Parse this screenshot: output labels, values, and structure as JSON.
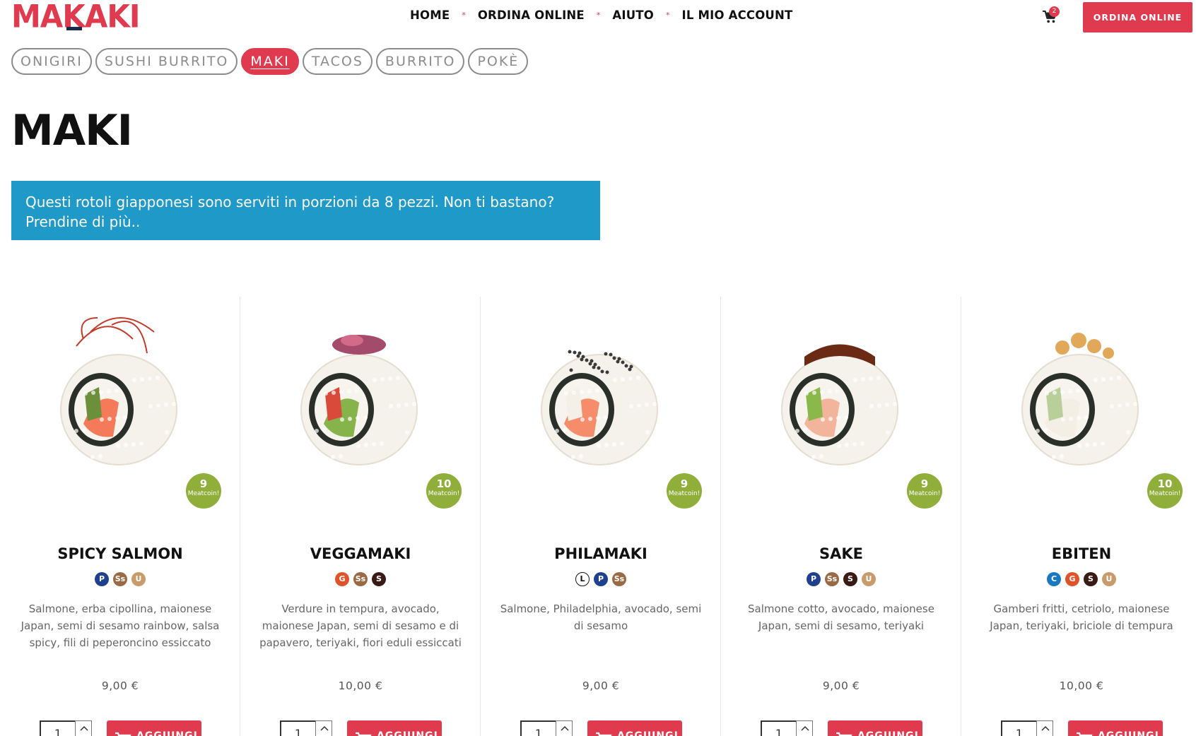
{
  "header": {
    "logo": "MAKAKI",
    "nav": [
      {
        "label": "HOME"
      },
      {
        "label": "ORDINA ONLINE"
      },
      {
        "label": "AIUTO"
      },
      {
        "label": "IL MIO ACCOUNT"
      }
    ],
    "nav_separator": "*",
    "cart_count": "2",
    "cta_label": "ORDINA ONLINE"
  },
  "categories": [
    {
      "label": "ONIGIRI",
      "active": false
    },
    {
      "label": "SUSHI BURRITO",
      "active": false
    },
    {
      "label": "MAKI",
      "active": true
    },
    {
      "label": "TACOS",
      "active": false
    },
    {
      "label": "BURRITO",
      "active": false
    },
    {
      "label": "POKÈ",
      "active": false
    }
  ],
  "page_title": "MAKI",
  "info_text": "Questi rotoli giapponesi sono serviti in porzioni da 8 pezzi. Non ti bastano? Prendine di più..",
  "badge_label": "Meatcoin!",
  "add_label": "AGGIUNGI",
  "qty_default": "1",
  "allergen_colors": {
    "P": "#1f3f8f",
    "Ss": "#9a6a45",
    "U": "#c99a6a",
    "G": "#e0522a",
    "S": "#3a1a14",
    "L": "#ffffff",
    "C": "#1a78c2"
  },
  "products": [
    {
      "name": "SPICY SALMON",
      "allergens": [
        "P",
        "Ss",
        "U"
      ],
      "description": "Salmone, erba cipollina, maionese Japan, semi di sesamo rainbow, salsa spicy, fili di peperoncino essiccato",
      "price": "9,00 €",
      "coins": "9"
    },
    {
      "name": "VEGGAMAKI",
      "allergens": [
        "G",
        "Ss",
        "S"
      ],
      "description": "Verdure in tempura, avocado, maionese Japan, semi di sesamo e di papavero, teriyaki, fiori eduli essiccati",
      "price": "10,00 €",
      "coins": "10"
    },
    {
      "name": "PHILAMAKI",
      "allergens": [
        "L",
        "P",
        "Ss"
      ],
      "description": "Salmone, Philadelphia, avocado, semi di sesamo",
      "price": "9,00 €",
      "coins": "9"
    },
    {
      "name": "SAKE",
      "allergens": [
        "P",
        "Ss",
        "S",
        "U"
      ],
      "description": "Salmone cotto, avocado, maionese Japan, semi di sesamo, teriyaki",
      "price": "9,00 €",
      "coins": "9"
    },
    {
      "name": "EBITEN",
      "allergens": [
        "C",
        "G",
        "S",
        "U"
      ],
      "description": "Gamberi fritti, cetriolo, maionese Japan, teriyaki, briciole di tempura",
      "price": "10,00 €",
      "coins": "10"
    }
  ]
}
